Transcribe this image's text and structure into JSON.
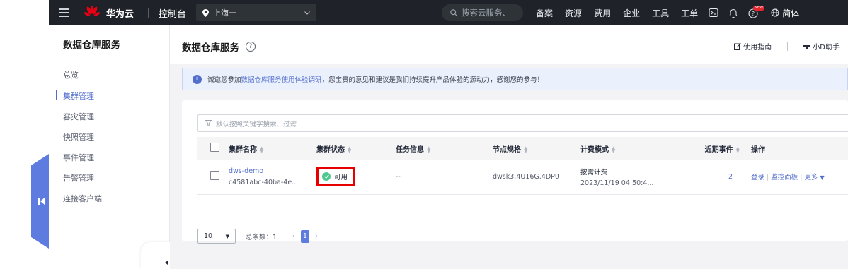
{
  "topbar": {
    "brand": "华为云",
    "console": "控制台",
    "region": "上海一",
    "search_placeholder": "搜索云服务、",
    "nav": [
      "备案",
      "资源",
      "费用",
      "企业",
      "工具",
      "工单"
    ],
    "lang": "简体",
    "new_badge": "NEW"
  },
  "sidenav": {
    "title": "数据仓库服务",
    "items": [
      "总览",
      "集群管理",
      "容灾管理",
      "快照管理",
      "事件管理",
      "告警管理",
      "连接客户端"
    ],
    "active_index": 1
  },
  "header": {
    "title": "数据仓库服务",
    "guide": "使用指南",
    "assistant": "小D助手"
  },
  "notice": {
    "prefix": "诚邀您参加",
    "link": "数据仓库服务使用体验调研",
    "suffix": "，您宝贵的意见和建议是我们持续提升产品体验的源动力，感谢您的参与！"
  },
  "filter": {
    "placeholder": "默认按照关键字搜索、过滤"
  },
  "table": {
    "columns": [
      "集群名称",
      "集群状态",
      "任务信息",
      "节点规格",
      "计费模式",
      "近期事件",
      "操作"
    ],
    "rows": [
      {
        "name": "dws-demo",
        "id": "c4581abc-40ba-4e...",
        "status": "可用",
        "task": "--",
        "spec": "dwsk3.4U16G.4DPU",
        "billing": "按需计费",
        "billing_time": "2023/11/19 04:50:4...",
        "events": "2",
        "ops": [
          "登录",
          "监控面板",
          "更多"
        ]
      }
    ]
  },
  "pager": {
    "size": "10",
    "total": "总条数：1",
    "page": "1"
  },
  "colors": {
    "accent": "#526ecc",
    "topbar": "#1f2329",
    "status_ok": "#4ec98e",
    "highlight": "#e60000"
  }
}
